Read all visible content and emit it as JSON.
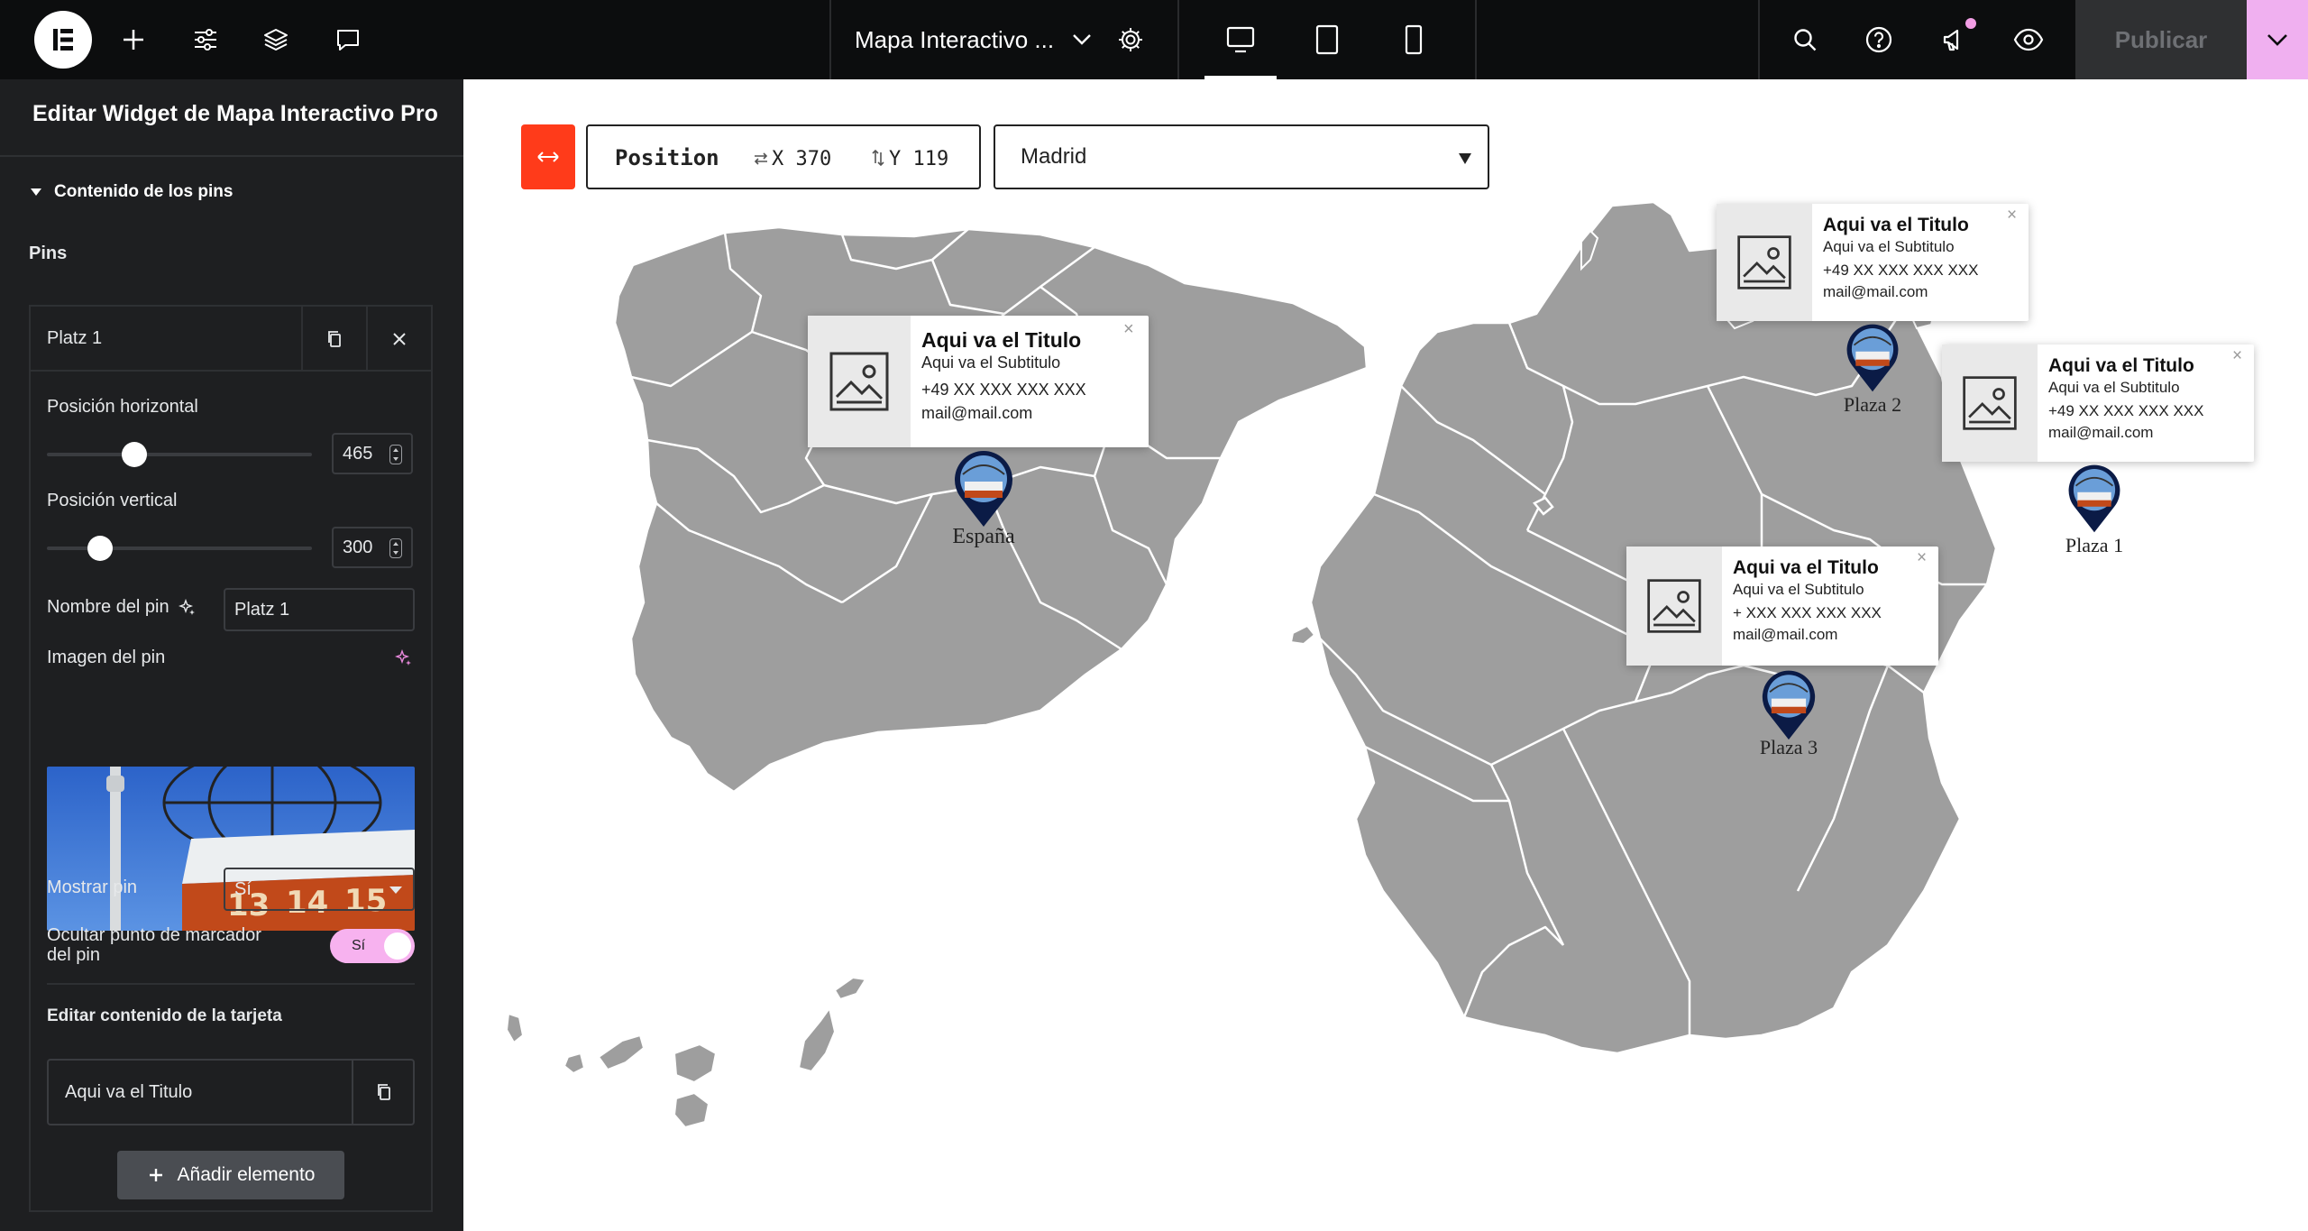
{
  "topbar": {
    "document_title": "Mapa Interactivo ...",
    "publish_label": "Publicar",
    "colors": {
      "background": "#0c0d0e",
      "publish_menu": "#f0b0f0",
      "notification": "#f39ee5"
    },
    "left_icons": [
      "elementor-logo-icon",
      "plus-icon",
      "sliders-icon",
      "layers-icon",
      "comment-icon"
    ],
    "device_icons": [
      "desktop-icon",
      "tablet-icon",
      "mobile-icon"
    ],
    "right_icons": [
      "search-icon",
      "help-icon",
      "megaphone-icon",
      "eye-icon"
    ]
  },
  "sidebar": {
    "title": "Editar Widget de Mapa Interactivo Pro",
    "section_title": "Contenido de los pins",
    "pins_label": "Pins",
    "item_title": "Platz 1",
    "horizontal_label": "Posición horizontal",
    "horizontal_value": "465",
    "vertical_label": "Posición vertical",
    "vertical_value": "300",
    "horizontal_slider_fraction": 0.33,
    "vertical_slider_fraction": 0.2,
    "pin_name_label": "Nombre del pin",
    "pin_name_value": "Platz 1",
    "pin_image_label": "Imagen del pin",
    "show_pin_label": "Mostrar pin",
    "show_pin_value": "Sí",
    "hide_marker_label": "Ocultar punto de marcador del pin",
    "hide_marker_toggle": "Sí",
    "card_content_title": "Editar contenido de la tarjeta",
    "card_item_title": "Aqui va el Titulo",
    "add_element_label": "Añadir elemento"
  },
  "canvas": {
    "position_label": "Position",
    "x_value": "X 370",
    "y_value": "Y 119",
    "location_select": "Madrid",
    "map_fill": "#9e9e9e",
    "cards": [
      {
        "title": "Aqui va el Titulo",
        "subtitle": "Aqui va el Subtitulo",
        "phone": "+49 XX XXX XXX XXX",
        "email": "mail@mail.com",
        "close": "×"
      },
      {
        "title": "Aqui va el Titulo",
        "subtitle": "Aqui va el Subtitulo",
        "phone": "+49 XX XXX XXX XXX",
        "email": "mail@mail.com",
        "close": "×"
      },
      {
        "title": "Aqui va el Titulo",
        "subtitle": "Aqui va el Subtitulo",
        "phone": "+49 XX XXX XXX XXX",
        "email": "mail@mail.com",
        "close": "×"
      },
      {
        "title": "Aqui va el Titulo",
        "subtitle": "Aqui va el Subtitulo",
        "phone": "+ XXX XXX XXX XXX",
        "email": "mail@mail.com",
        "close": "×"
      }
    ],
    "pins": [
      {
        "label": "España"
      },
      {
        "label": "Plaza 2"
      },
      {
        "label": "Plaza 1"
      },
      {
        "label": "Plaza 3"
      }
    ]
  }
}
